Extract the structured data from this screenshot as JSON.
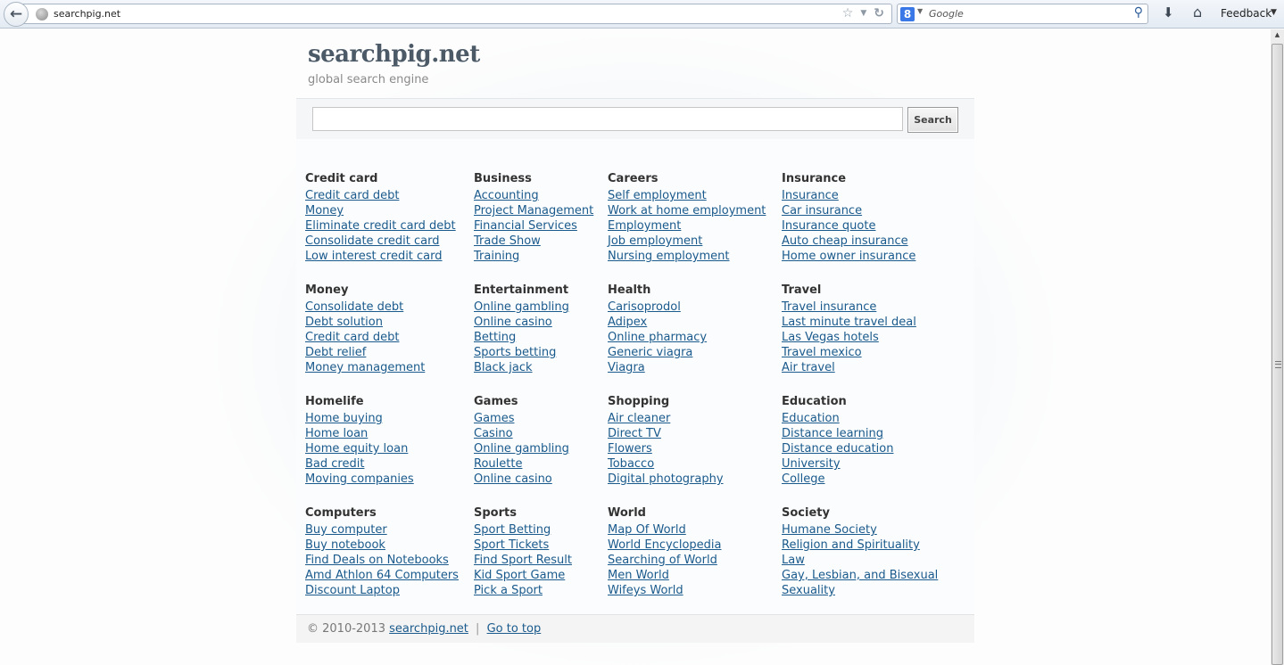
{
  "browser": {
    "url": "searchpig.net",
    "search_engine": "Google",
    "search_placeholder": "Google",
    "feedback_label": "Feedback"
  },
  "site": {
    "title": "searchpig.net",
    "tagline": "global search engine",
    "search_value": "",
    "search_button": "Search"
  },
  "categories": [
    {
      "title": "Credit card",
      "links": [
        "Credit card debt",
        "Money",
        "Eliminate credit card debt",
        "Consolidate credit card",
        "Low interest credit card"
      ]
    },
    {
      "title": "Business",
      "links": [
        "Accounting",
        "Project Management",
        "Financial Services",
        "Trade Show",
        "Training"
      ]
    },
    {
      "title": "Careers",
      "links": [
        "Self employment",
        "Work at home employment",
        "Employment",
        "Job employment",
        "Nursing employment"
      ]
    },
    {
      "title": "Insurance",
      "links": [
        "Insurance",
        "Car insurance",
        "Insurance quote",
        "Auto cheap insurance",
        "Home owner insurance"
      ]
    },
    {
      "title": "Money",
      "links": [
        "Consolidate debt",
        "Debt solution",
        "Credit card debt",
        "Debt relief",
        "Money management"
      ]
    },
    {
      "title": "Entertainment",
      "links": [
        "Online gambling",
        "Online casino",
        "Betting",
        "Sports betting",
        "Black jack"
      ]
    },
    {
      "title": "Health",
      "links": [
        "Carisoprodol",
        "Adipex",
        "Online pharmacy",
        "Generic viagra",
        "Viagra"
      ]
    },
    {
      "title": "Travel",
      "links": [
        "Travel insurance",
        "Last minute travel deal",
        "Las Vegas hotels",
        "Travel mexico",
        "Air travel"
      ]
    },
    {
      "title": "Homelife",
      "links": [
        "Home buying",
        "Home loan",
        "Home equity loan",
        "Bad credit",
        "Moving companies"
      ]
    },
    {
      "title": "Games",
      "links": [
        "Games",
        "Casino",
        "Online gambling",
        "Roulette",
        "Online casino"
      ]
    },
    {
      "title": "Shopping",
      "links": [
        "Air cleaner",
        "Direct TV",
        "Flowers",
        "Tobacco",
        "Digital photography"
      ]
    },
    {
      "title": "Education",
      "links": [
        "Education",
        "Distance learning",
        "Distance education",
        "University",
        "College"
      ]
    },
    {
      "title": "Computers",
      "links": [
        "Buy computer",
        "Buy notebook",
        "Find Deals on Notebooks",
        "Amd Athlon 64 Computers",
        "Discount Laptop"
      ]
    },
    {
      "title": "Sports",
      "links": [
        "Sport Betting",
        "Sport Tickets",
        "Find Sport Result",
        "Kid Sport Game",
        "Pick a Sport"
      ]
    },
    {
      "title": "World",
      "links": [
        "Map Of World",
        "World Encyclopedia",
        "Searching of World",
        "Men World",
        "Wifeys World"
      ]
    },
    {
      "title": "Society",
      "links": [
        "Humane Society",
        "Religion and Spirituality",
        "Law",
        "Gay, Lesbian, and Bisexual",
        "Sexuality"
      ]
    }
  ],
  "footer": {
    "copyright": "© 2010-2013",
    "site_link": "searchpig.net",
    "separator": "|",
    "top_link": "Go to top"
  }
}
